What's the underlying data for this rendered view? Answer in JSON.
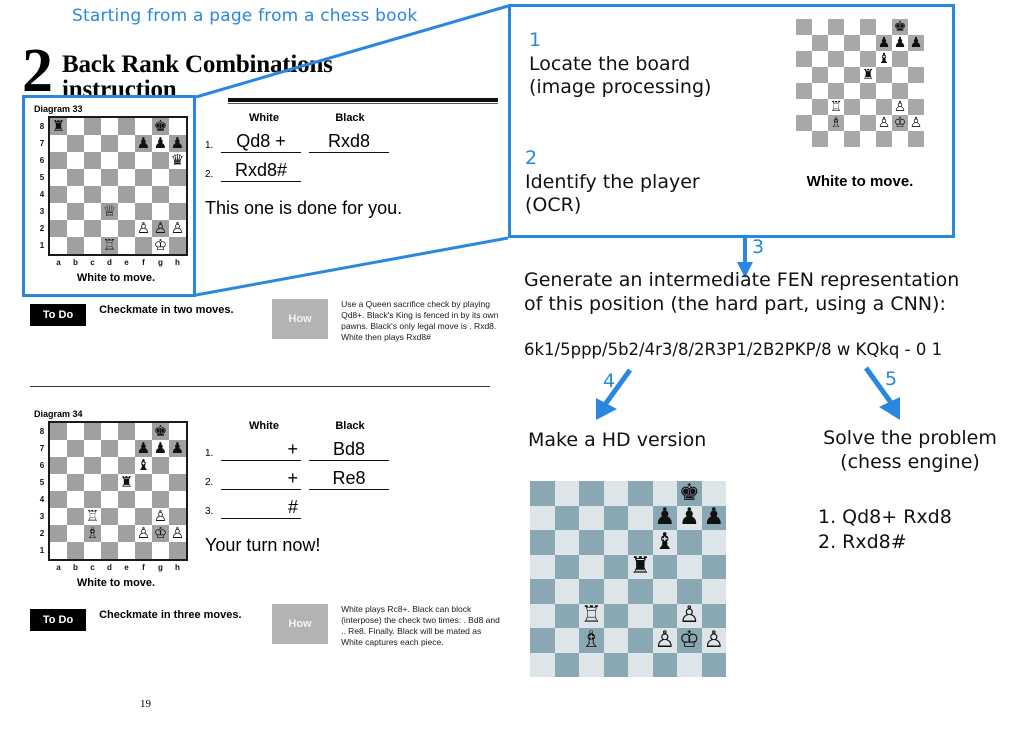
{
  "caption": "Starting from a page from a chess book",
  "book": {
    "chapter_number": "2",
    "chapter_title_line1": "Back Rank Combinations",
    "chapter_title_line2": "instruction",
    "page_number": "19",
    "diagram33": {
      "label": "Diagram 33",
      "to_move": "White to move.",
      "files": [
        "a",
        "b",
        "c",
        "d",
        "e",
        "f",
        "g",
        "h"
      ],
      "ranks": [
        "8",
        "7",
        "6",
        "5",
        "4",
        "3",
        "2",
        "1"
      ],
      "pieces": {
        "a8": "black-rook",
        "g8": "black-king",
        "f7": "black-pawn",
        "g7": "black-pawn",
        "h7": "black-pawn",
        "h6": "black-queen",
        "d3": "white-queen",
        "f2": "white-pawn",
        "g2": "white-pawn",
        "h2": "white-pawn",
        "d1": "white-rook",
        "g1": "white-king"
      },
      "moves_header": {
        "num": "",
        "white": "White",
        "black": "Black"
      },
      "moves": [
        {
          "num": "1.",
          "white": "Qd8 +",
          "black": "Rxd8"
        },
        {
          "num": "2.",
          "white": "Rxd8#",
          "black": ""
        }
      ],
      "note": "This one is done for you.",
      "todo_tag": "To Do",
      "todo_text": "Checkmate in two moves.",
      "how_tag": "How",
      "how_text": "Use a Queen sacrifice check by playing Qd8+. Black's King is fenced in by its own pawns. Black's only legal move is . Rxd8. White then plays Rxd8#"
    },
    "diagram34": {
      "label": "Diagram 34",
      "to_move": "White to move.",
      "files": [
        "a",
        "b",
        "c",
        "d",
        "e",
        "f",
        "g",
        "h"
      ],
      "ranks": [
        "8",
        "7",
        "6",
        "5",
        "4",
        "3",
        "2",
        "1"
      ],
      "pieces": {
        "g8": "black-king",
        "f7": "black-pawn",
        "g7": "black-pawn",
        "h7": "black-pawn",
        "f6": "black-bishop",
        "e5": "black-rook",
        "c3": "white-rook",
        "g3": "white-pawn",
        "c2": "white-bishop",
        "f2": "white-pawn",
        "g2": "white-king",
        "h2": "white-pawn"
      },
      "moves_header": {
        "num": "",
        "white": "White",
        "black": "Black"
      },
      "moves": [
        {
          "num": "1.",
          "white": "+",
          "black": "Bd8"
        },
        {
          "num": "2.",
          "white": "+",
          "black": "Re8"
        },
        {
          "num": "3.",
          "white": "#",
          "black": ""
        }
      ],
      "note": "Your turn now!",
      "todo_tag": "To Do",
      "todo_text": "Checkmate in three moves.",
      "how_tag": "How",
      "how_text": "White plays Rc8+. Black can block (interpose) the check two times: . Bd8 and .. Re8. Finally. Black will be mated as White captures each piece."
    }
  },
  "pipeline": {
    "step1": {
      "number": "1",
      "line1": "Locate the board",
      "line2": "(image processing)"
    },
    "step2": {
      "number": "2",
      "line1": "Identify the player",
      "line2": "(OCR)"
    },
    "callout_board": {
      "caption": "White to move.",
      "pieces": {
        "g8": "black-king",
        "f7": "black-pawn",
        "g7": "black-pawn",
        "h7": "black-pawn",
        "f6": "black-bishop",
        "e5": "black-rook",
        "c3": "white-rook",
        "g3": "white-pawn",
        "c2": "white-bishop",
        "f2": "white-pawn",
        "g2": "white-king",
        "h2": "white-pawn"
      }
    },
    "step3": {
      "number": "3",
      "line1": "Generate an intermediate FEN representation",
      "line2": "of this position (the hard part, using a CNN):",
      "fen": "6k1/5ppp/5b2/4r3/8/2R3P1/2B2PKP/8 w KQkq - 0 1"
    },
    "step4": {
      "number": "4",
      "title": "Make a HD version",
      "board": {
        "light_color": "#dde5e9",
        "dark_color": "#8aa7b4",
        "pieces": {
          "g8": "black-king",
          "f7": "black-pawn",
          "g7": "black-pawn",
          "h7": "black-pawn",
          "f6": "black-bishop",
          "e5": "black-rook",
          "c3": "white-rook",
          "g3": "white-pawn",
          "c2": "white-bishop",
          "f2": "white-pawn",
          "g2": "white-king",
          "h2": "white-pawn"
        }
      }
    },
    "step5": {
      "number": "5",
      "title_line1": "Solve the problem",
      "title_line2": "(chess engine)",
      "solution_line1": "1. Qd8+ Rxd8",
      "solution_line2": "2. Rxd8#"
    }
  },
  "colors": {
    "accent_blue": "#2a87e0",
    "todo_bg": "#000000",
    "how_bg": "#b3b3b3"
  }
}
